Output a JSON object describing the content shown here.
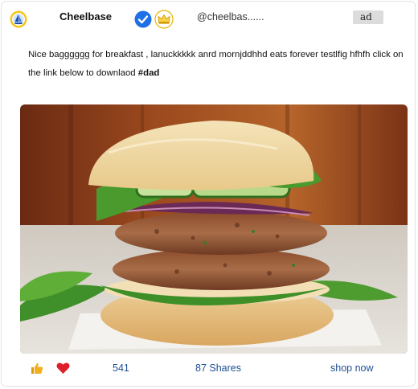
{
  "post": {
    "brand_name": "Cheelbase",
    "handle": "@cheelbas......",
    "ad_label": "ad",
    "text": "Nice bagggggg for breakfast , lanuckkkkk anrd mornjddhhd eats forever testlfig hfhfh click on the link below to downlaod ",
    "hashtag": "#dad"
  },
  "media": {
    "image_subject": "burger-photo"
  },
  "engagement": {
    "likes": "541",
    "shares": "87 Shares",
    "cta": "shop now"
  },
  "icons": {
    "avatar": "sailboat-logo-icon",
    "verified": "verified-check-icon",
    "premium": "crown-icon",
    "like": "thumbs-up-icon",
    "love": "heart-icon"
  },
  "colors": {
    "link": "#1d4f91",
    "verified": "#1f6fe5",
    "crown": "#e8b400",
    "heart": "#e01d2b",
    "like": "#f2b01e"
  }
}
